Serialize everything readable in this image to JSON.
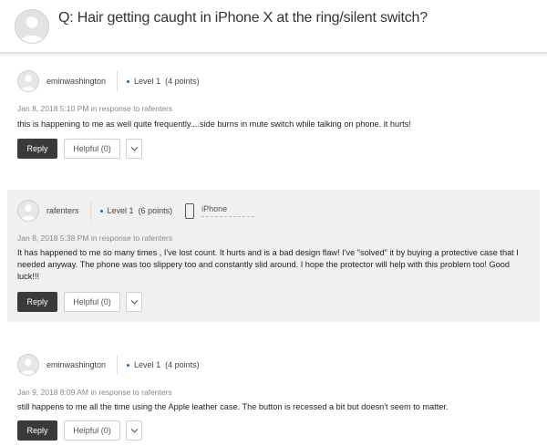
{
  "question": {
    "prefix": "Q:",
    "title": "Hair getting caught in iPhone X at the ring/silent switch?"
  },
  "posts": [
    {
      "username": "eminwashington",
      "level": "Level 1",
      "points": "(4 points)",
      "timestamp": "Jan 8, 2018 5:10 PM",
      "in_response": "in response to rafenters",
      "body": "this is happening to me as well quite frequently....side burns in mute switch while talking on phone.  it hurts!",
      "reply_label": "Reply",
      "helpful_label": "Helpful (0)"
    },
    {
      "username": "rafenters",
      "level": "Level 1",
      "points": "(6 points)",
      "device": "iPhone",
      "timestamp": "Jan 8, 2018 5:38 PM",
      "in_response": "in response to rafenters",
      "body": "It has happened to me so many times , I've lost count.  It hurts and is a bad design flaw!  I've \"solved\" it by buying a protective case that I needed anyway.  The phone was too slippery too and constantly slid around.  I hope the protector will help with this problem too!  Good luck!!!",
      "reply_label": "Reply",
      "helpful_label": "Helpful (0)"
    },
    {
      "username": "eminwashington",
      "level": "Level 1",
      "points": "(4 points)",
      "timestamp": "Jan 9, 2018 8:09 AM",
      "in_response": "in response to rafenters",
      "body": "still happens to me all the time using the Apple leather case. The button is recessed a bit but doesn't seem to matter.",
      "reply_label": "Reply",
      "helpful_label": "Helpful (0)"
    }
  ],
  "icons": {
    "avatar": "user-silhouette-icon",
    "device": "phone-icon",
    "more": "chevron-down-icon"
  },
  "colors": {
    "reply_button": "#3a3a3a",
    "level_dot": "#0070c9",
    "shaded_post": "#f0f0f0"
  }
}
